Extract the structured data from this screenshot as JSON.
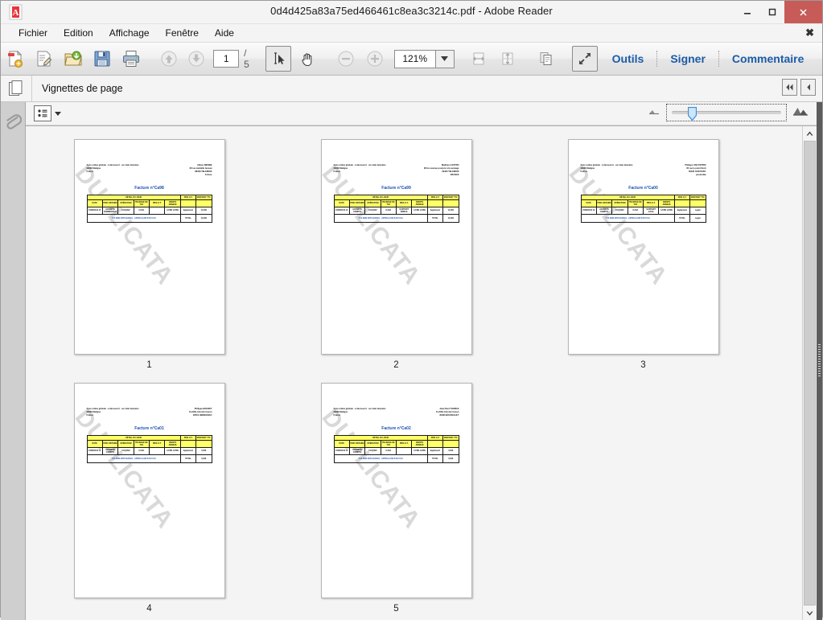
{
  "window": {
    "title": "0d4d425a83a75ed466461c8ea3c3214c.pdf - Adobe Reader",
    "app_icon": "adobe-reader-icon",
    "minimize_label": "–",
    "maximize_label": "☐",
    "close_label": "×"
  },
  "menubar": {
    "items": [
      {
        "label": "Fichier",
        "mnemonic": "h"
      },
      {
        "label": "Edition",
        "mnemonic": "d"
      },
      {
        "label": "Affichage",
        "mnemonic": "A"
      },
      {
        "label": "Fenêtre",
        "mnemonic": "ê"
      },
      {
        "label": "Aide",
        "mnemonic": "i"
      }
    ],
    "close_label": "✖"
  },
  "toolbar": {
    "buttons": [
      {
        "name": "create-pdf-button",
        "title": "Créer PDF"
      },
      {
        "name": "edit-pdf-button",
        "title": "Modifier"
      },
      {
        "name": "open-file-button",
        "title": "Ouvrir"
      },
      {
        "name": "save-file-button",
        "title": "Enregistrer"
      },
      {
        "name": "print-button",
        "title": "Imprimer"
      },
      {
        "name": "previous-page-button",
        "title": "Page précédente"
      },
      {
        "name": "next-page-button",
        "title": "Page suivante"
      },
      {
        "name": "select-tool-button",
        "title": "Sélection"
      },
      {
        "name": "hand-tool-button",
        "title": "Main"
      },
      {
        "name": "zoom-out-button",
        "title": "Zoom arrière"
      },
      {
        "name": "zoom-in-button",
        "title": "Zoom avant"
      },
      {
        "name": "fit-width-button",
        "title": "Largeur"
      },
      {
        "name": "fit-page-button",
        "title": "Page entière"
      },
      {
        "name": "page-display-button",
        "title": "Affichage des pages"
      },
      {
        "name": "fullscreen-button",
        "title": "Plein écran"
      }
    ],
    "page_current": "1",
    "page_total": "/ 5",
    "zoom_value": "121%",
    "links": [
      {
        "label": "Outils"
      },
      {
        "label": "Signer"
      },
      {
        "label": "Commentaire"
      }
    ]
  },
  "panel": {
    "title": "Vignettes de page",
    "icon": "page-thumbnails-icon",
    "collapse_all_label": "◀◀",
    "collapse_label": "◀",
    "rail_icon": "paperclip-icon",
    "options_icon": "list-options-icon",
    "slider": {
      "small_icon": "small-thumbnails-icon",
      "large_icon": "large-thumbnails-icon",
      "value": "22"
    }
  },
  "thumbnails": [
    {
      "page_label": "1",
      "watermark": "DUPLICATA",
      "addr_left": [
        "Zone unitée globale - à découvert - sur date bancaire",
        "32960 Maligne",
        "France"
      ],
      "addr_right": [
        "Abbas DIENNE",
        "38 rue médaille bureau",
        "88428 TELEMOIS",
        "France"
      ],
      "invoice_title": "Facture n°Ca98",
      "table": {
        "group_header": "DÉTAIL DU JOUR",
        "right_headers": [
          "PRIX H.T.",
          "MONTANT TTC"
        ],
        "columns": [
          "DATE",
          "PRIX UNITAIRE",
          "OPÉRATION",
          "TRANCHE DE TVA",
          "PRIX H.T.",
          "DROITS ANNEXE"
        ],
        "row": [
          "04/08/2013 13",
          "ACOMPTE COMMERCIAL",
          "CLIQUEZ",
          "CASA",
          "",
          "LIVRE LIVRE"
        ],
        "right_values": [
          "Egalement",
          "12,00€"
        ],
        "note": "TVA NON APPLICABLE - ARTICLE 293 B DU CGI",
        "footer_label": "TOTAL",
        "footer_value": "12,00€"
      }
    },
    {
      "page_label": "2",
      "watermark": "DUPLICATA",
      "addr_left": [
        "Zone unitée globale - à découvert - sur date bancaire",
        "32960 Maligne",
        "France"
      ],
      "addr_right": [
        "Mathieu CASTRO",
        "28 bis avenue pourpre à la sauvage",
        "29420 TELEMOIS",
        "FRANCE"
      ],
      "invoice_title": "Facture n°Ca99",
      "table": {
        "group_header": "DÉTAIL DU JOUR",
        "right_headers": [
          "PRIX H.T.",
          "MONTANT TTC"
        ],
        "columns": [
          "DATE",
          "PRIX UNITAIRE",
          "OPÉRATION",
          "TRANCHE DE TVA",
          "PRIX H.T.",
          "DROITS ANNEXE"
        ],
        "row": [
          "04/08/2013 13",
          "ACOMPTE COMPTE",
          "CLIQUEZ",
          "CASA",
          "SUPPORT SIMPLE",
          "LIVRE LIVRE"
        ],
        "right_values": [
          "Egalement",
          "12,00€"
        ],
        "note": "TVA NON APPLICABLE - ARTICLE 293 B DU CGI",
        "footer_label": "TOTAL",
        "footer_value": "12,00€"
      }
    },
    {
      "page_label": "3",
      "watermark": "DUPLICATA",
      "addr_left": [
        "Zone unitée globale - à découvert - sur date bancaire",
        "32960 Maligne",
        "France"
      ],
      "addr_right": [
        "Philippe VAN PETRIS",
        "35 rue le point Nord",
        "60330 GOFFIGNY",
        "pouloufaa"
      ],
      "invoice_title": "Facture n°Ca00",
      "table": {
        "group_header": "DÉTAIL DU JOUR",
        "right_headers": [
          "PRIX H.T.",
          "MONTANT TTC"
        ],
        "columns": [
          "DATE",
          "PRIX UNITAIRE",
          "OPÉRATION",
          "TRANCHE DE TVA",
          "PRIX H.T.",
          "DROITS ANNEXE"
        ],
        "row": [
          "04/08/2013 13",
          "ACOMPTE COMPTE",
          "CLIQUEZ",
          "CASA",
          "SUPPORT CASA",
          "LIVRE LIVRE"
        ],
        "right_values": [
          "Egalement",
          "cegler"
        ],
        "note": "TVA NON APPLICABLE - ARTICLE 293 B DU CGI",
        "footer_label": "TOTAL",
        "footer_value": "cegler"
      }
    },
    {
      "page_label": "4",
      "watermark": "DUPLICATA",
      "addr_left": [
        "Zone unitée globale - à découvert - sur date bancaire",
        "32960 Maligne",
        "France"
      ],
      "addr_right": [
        "Philippe BOURET",
        "CLAIRe Antonin Canon",
        "32510 HERBIGNAC"
      ],
      "invoice_title": "Facture n°Ca01",
      "table": {
        "group_header": "DÉTAIL DU JOUR",
        "right_headers": [
          "PRIX H.T.",
          "MONTANT TTC"
        ],
        "columns": [
          "DATE",
          "PRIX UNITAIRE",
          "OPÉRATION",
          "TRANCHE DE TVA",
          "PRIX H.T.",
          "DROITS ANNEXE"
        ],
        "row": [
          "04/08/2013 13",
          "ACOMPTE COMPTE",
          "CLIQUEZ",
          "CASA",
          "",
          "LIVRE LIVRE"
        ],
        "right_values": [
          "Egalement",
          "0,00€"
        ],
        "note": "TVA NON APPLICABLE - ARTICLE 293 B DU CGI",
        "footer_label": "TOTAL",
        "footer_value": "0,00€"
      }
    },
    {
      "page_label": "5",
      "watermark": "DUPLICATA",
      "addr_left": [
        "Zone unitée globale - à découvert - sur date bancaire",
        "32960 Maligne",
        "France"
      ],
      "addr_right": [
        "Jean-Paul THOMAS",
        "CLAIRe Antonin Canon",
        "32480 BOURGAULT"
      ],
      "invoice_title": "Facture n°Ca02",
      "table": {
        "group_header": "DÉTAIL DU JOUR",
        "right_headers": [
          "PRIX H.T.",
          "MONTANT TTC"
        ],
        "columns": [
          "DATE",
          "PRIX UNITAIRE",
          "OPÉRATION",
          "TRANCHE DE TVA",
          "PRIX H.T.",
          "DROITS ANNEXE"
        ],
        "row": [
          "04/08/2013 13",
          "ACOMPTE COMPTE",
          "CLIQUEZ",
          "CASA",
          "",
          "LIVRE LIVRE"
        ],
        "right_values": [
          "Egalement",
          "0,00€"
        ],
        "note": "TVA NON APPLICABLE - ARTICLE 293 B DU CGI",
        "footer_label": "TOTAL",
        "footer_value": "0,00€"
      }
    }
  ],
  "colors": {
    "accent_blue": "#1c5ca8",
    "close_red": "#c75b57",
    "table_yellow": "#ffff66",
    "invoice_blue": "#1a4fb4",
    "watermark_gray": "#d9d9d9"
  }
}
